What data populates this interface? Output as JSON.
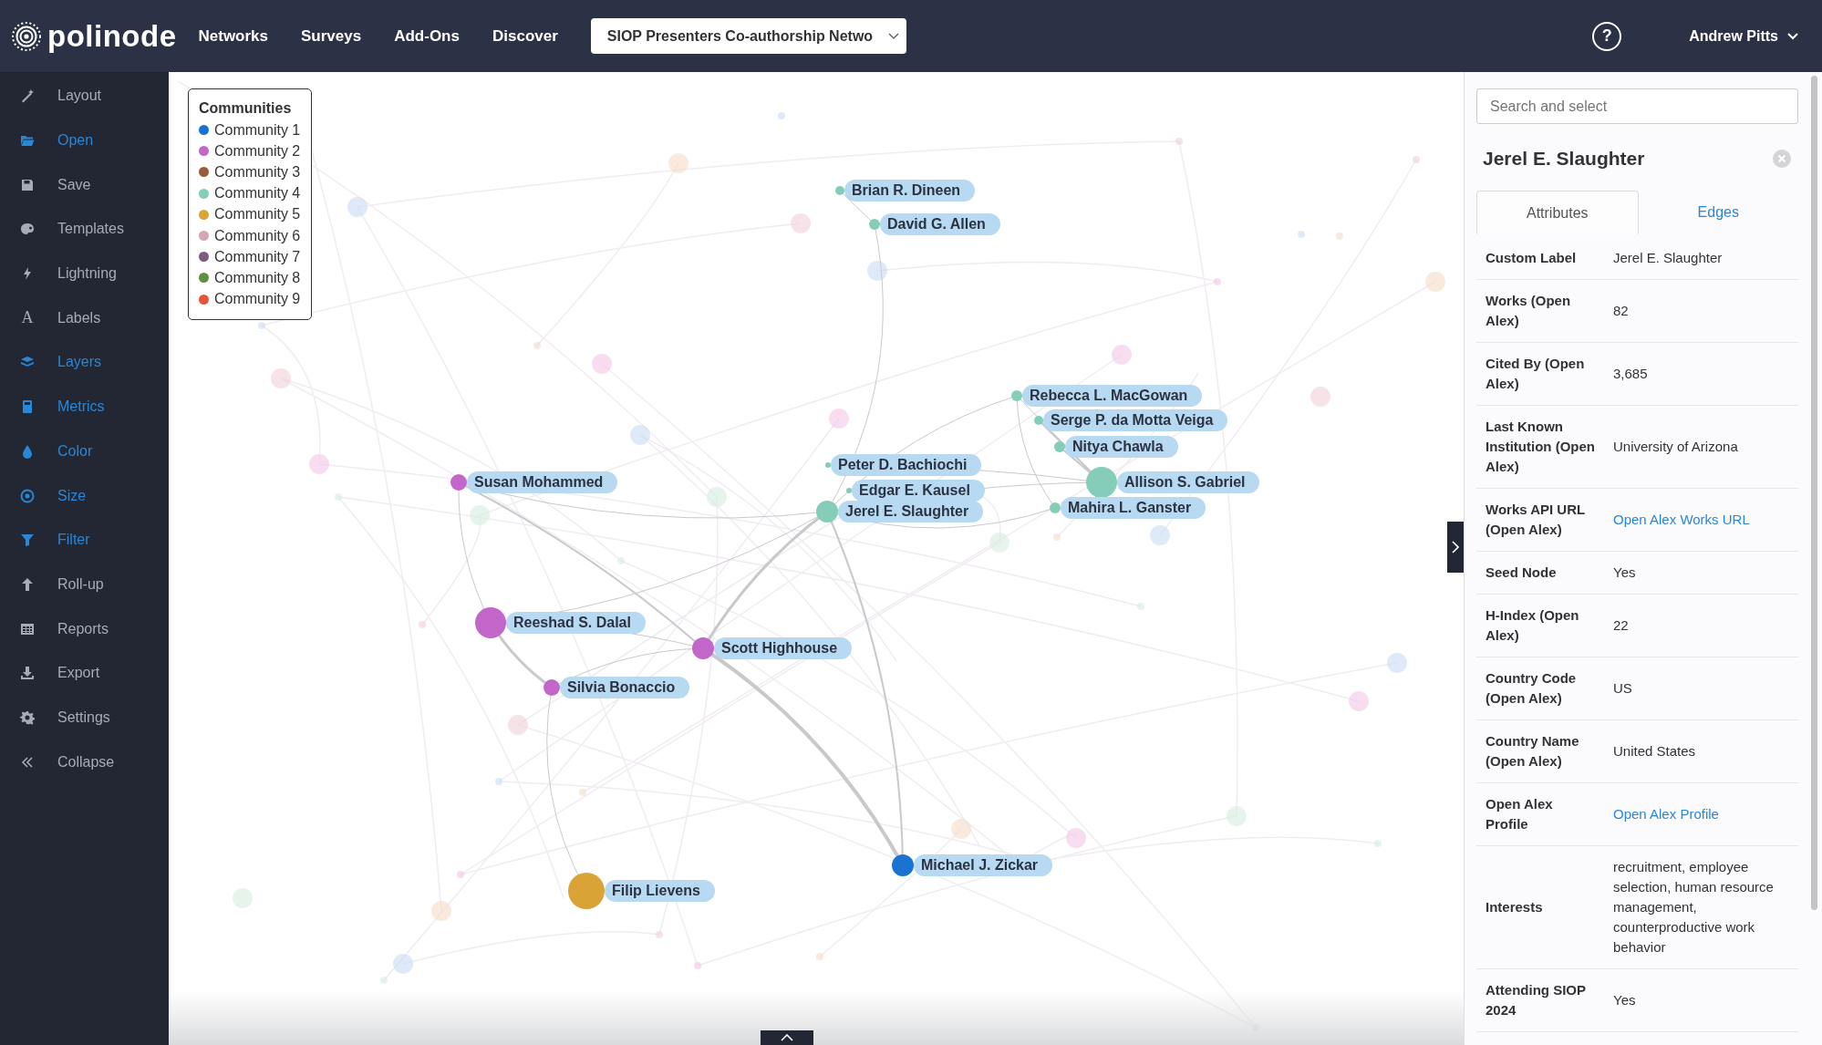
{
  "topbar": {
    "logo": "polinode",
    "nav": [
      "Networks",
      "Surveys",
      "Add-Ons",
      "Discover"
    ],
    "network_select": {
      "value": "SIOP Presenters Co-authorship Netwo"
    },
    "help": "?",
    "user": "Andrew Pitts"
  },
  "sidebar": {
    "items": [
      {
        "label": "Layout",
        "active": false
      },
      {
        "label": "Open",
        "active": true
      },
      {
        "label": "Save",
        "active": false
      },
      {
        "label": "Templates",
        "active": false
      },
      {
        "label": "Lightning",
        "active": false
      },
      {
        "label": "Labels",
        "active": false,
        "glyph": "A"
      },
      {
        "label": "Layers",
        "active": true
      },
      {
        "label": "Metrics",
        "active": true
      },
      {
        "label": "Color",
        "active": true
      },
      {
        "label": "Size",
        "active": true
      },
      {
        "label": "Filter",
        "active": true
      },
      {
        "label": "Roll-up",
        "active": false
      },
      {
        "label": "Reports",
        "active": false
      },
      {
        "label": "Export",
        "active": false
      },
      {
        "label": "Settings",
        "active": false
      },
      {
        "label": "Collapse",
        "active": false
      }
    ]
  },
  "legend": {
    "title": "Communities",
    "items": [
      {
        "label": "Community 1",
        "color": "#1a73d1"
      },
      {
        "label": "Community 2",
        "color": "#c266c9"
      },
      {
        "label": "Community 3",
        "color": "#9c5a3c"
      },
      {
        "label": "Community 4",
        "color": "#85cdb8"
      },
      {
        "label": "Community 5",
        "color": "#d9a336"
      },
      {
        "label": "Community 6",
        "color": "#d6a5b5"
      },
      {
        "label": "Community 7",
        "color": "#7d5a80"
      },
      {
        "label": "Community 8",
        "color": "#5f9140"
      },
      {
        "label": "Community 9",
        "color": "#e4563a"
      }
    ]
  },
  "nodes": [
    {
      "label": "Brian R. Dineen",
      "color": "#85cdb8"
    },
    {
      "label": "David G. Allen",
      "color": "#85cdb8"
    },
    {
      "label": "Rebecca L. MacGowan",
      "color": "#85cdb8"
    },
    {
      "label": "Serge P. da Motta Veiga",
      "color": "#85cdb8"
    },
    {
      "label": "Nitya Chawla",
      "color": "#85cdb8"
    },
    {
      "label": "Peter D. Bachiochi",
      "color": "#85cdb8"
    },
    {
      "label": "Edgar E. Kausel",
      "color": "#85cdb8"
    },
    {
      "label": "Allison S. Gabriel",
      "color": "#85cdb8"
    },
    {
      "label": "Jerel E. Slaughter",
      "color": "#85cdb8"
    },
    {
      "label": "Mahira L. Ganster",
      "color": "#85cdb8"
    },
    {
      "label": "Susan Mohammed",
      "color": "#c266c9"
    },
    {
      "label": "Reeshad S. Dalal",
      "color": "#c266c9"
    },
    {
      "label": "Scott Highhouse",
      "color": "#c266c9"
    },
    {
      "label": "Silvia Bonaccio",
      "color": "#c266c9"
    },
    {
      "label": "Michael J. Zickar",
      "color": "#1a73d1"
    },
    {
      "label": "Filip Lievens",
      "color": "#d9a336"
    }
  ],
  "panel": {
    "search": {
      "placeholder": "Search and select"
    },
    "title": "Jerel E. Slaughter",
    "tabs": [
      {
        "label": "Attributes",
        "selected": true
      },
      {
        "label": "Edges",
        "selected": false
      }
    ],
    "attributes": [
      {
        "label": "Custom Label",
        "value": "Jerel E. Slaughter",
        "kind": "text"
      },
      {
        "label": "Works (Open Alex)",
        "value": "82",
        "kind": "text"
      },
      {
        "label": "Cited By (Open Alex)",
        "value": "3,685",
        "kind": "text"
      },
      {
        "label": "Last Known Institution (Open Alex)",
        "value": "University of Arizona",
        "kind": "text"
      },
      {
        "label": "Works API URL (Open Alex)",
        "value": "Open Alex Works URL",
        "kind": "link"
      },
      {
        "label": "Seed Node",
        "value": "Yes",
        "kind": "text"
      },
      {
        "label": "H-Index (Open Alex)",
        "value": "22",
        "kind": "text"
      },
      {
        "label": "Country Code (Open Alex)",
        "value": "US",
        "kind": "text"
      },
      {
        "label": "Country Name (Open Alex)",
        "value": "United States",
        "kind": "text"
      },
      {
        "label": "Open Alex Profile",
        "value": "Open Alex Profile",
        "kind": "link"
      },
      {
        "label": "Interests",
        "value": "recruitment, employee selection, human resource management, counterproductive work behavior",
        "kind": "text"
      },
      {
        "label": "Attending SIOP 2024",
        "value": "Yes",
        "kind": "text"
      }
    ]
  }
}
